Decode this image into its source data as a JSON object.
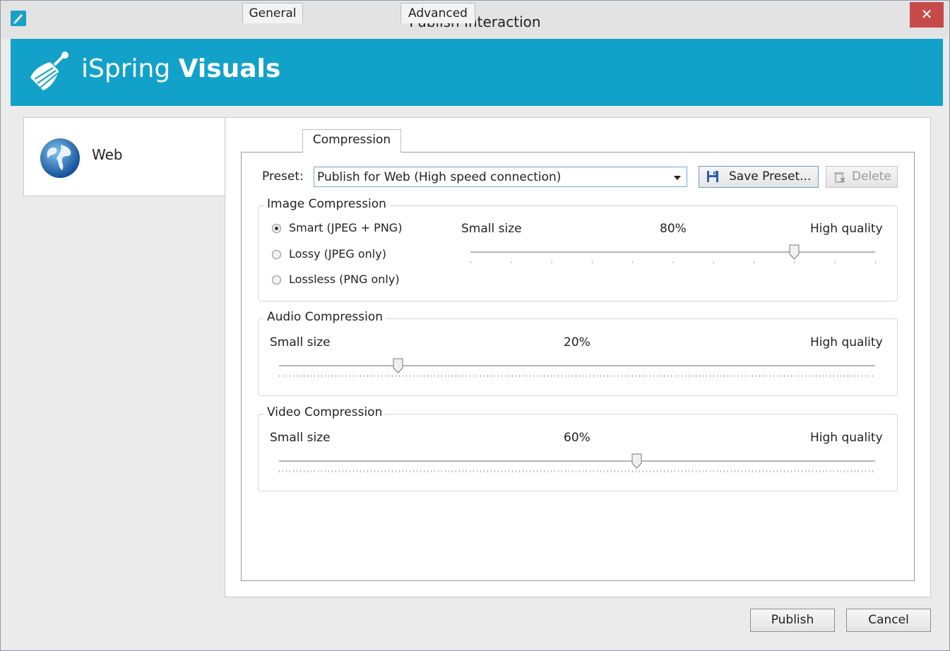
{
  "window": {
    "title": "Publish Interaction",
    "close_glyph": "✕"
  },
  "banner": {
    "brand_light": "iSpring ",
    "brand_bold": "Visuals",
    "color": "#12a2c9"
  },
  "left_panel": {
    "items": [
      {
        "label": "Web",
        "icon": "globe-icon"
      }
    ]
  },
  "tabs": [
    {
      "label": "General"
    },
    {
      "label": "Compression",
      "active": true
    },
    {
      "label": "Advanced"
    }
  ],
  "preset": {
    "label": "Preset:",
    "value": "Publish for Web (High speed connection)",
    "save_label": "Save Preset...",
    "delete_label": "Delete"
  },
  "image_compression": {
    "title": "Image Compression",
    "options": [
      {
        "label": "Smart (JPEG + PNG)",
        "selected": true
      },
      {
        "label": "Lossy (JPEG only)",
        "selected": false
      },
      {
        "label": "Lossless (PNG only)",
        "selected": false
      }
    ],
    "min_label": "Small size",
    "max_label": "High quality",
    "value_label": "80%",
    "value": 0.8
  },
  "audio_compression": {
    "title": "Audio Compression",
    "min_label": "Small size",
    "max_label": "High quality",
    "value_label": "20%",
    "value": 0.2
  },
  "video_compression": {
    "title": "Video Compression",
    "min_label": "Small size",
    "max_label": "High quality",
    "value_label": "60%",
    "value": 0.6
  },
  "footer": {
    "publish_label": "Publish",
    "cancel_label": "Cancel"
  }
}
